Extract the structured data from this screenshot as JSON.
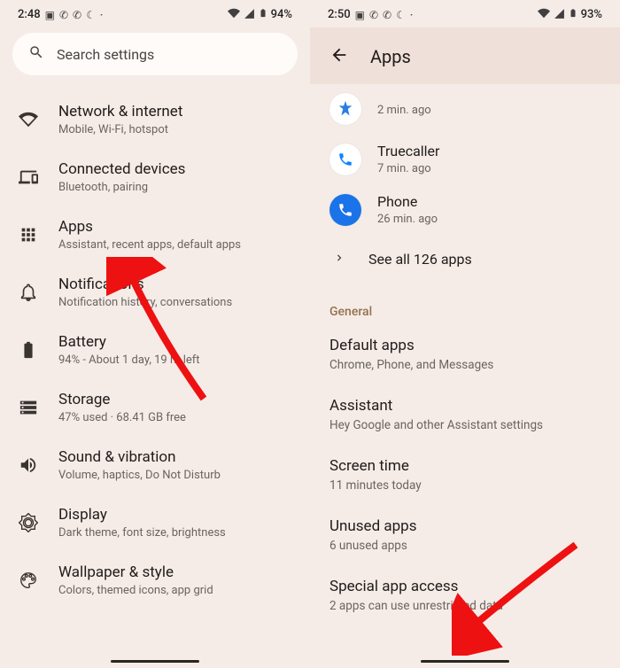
{
  "left": {
    "status": {
      "time": "2:48",
      "battery": "94%"
    },
    "search_placeholder": "Search settings",
    "items": [
      {
        "title": "Network & internet",
        "sub": "Mobile, Wi-Fi, hotspot"
      },
      {
        "title": "Connected devices",
        "sub": "Bluetooth, pairing"
      },
      {
        "title": "Apps",
        "sub": "Assistant, recent apps, default apps"
      },
      {
        "title": "Notifications",
        "sub": "Notification history, conversations"
      },
      {
        "title": "Battery",
        "sub": "94% - About 1 day, 19 hr left"
      },
      {
        "title": "Storage",
        "sub": "47% used · 68.41 GB free"
      },
      {
        "title": "Sound & vibration",
        "sub": "Volume, haptics, Do Not Disturb"
      },
      {
        "title": "Display",
        "sub": "Dark theme, font size, brightness"
      },
      {
        "title": "Wallpaper & style",
        "sub": "Colors, themed icons, app grid"
      }
    ]
  },
  "right": {
    "status": {
      "time": "2:50",
      "battery": "93%"
    },
    "header_title": "Apps",
    "recent": [
      {
        "name": "",
        "sub": "2 min. ago"
      },
      {
        "name": "Truecaller",
        "sub": "7 min. ago"
      },
      {
        "name": "Phone",
        "sub": "26 min. ago"
      }
    ],
    "see_all": "See all 126 apps",
    "section_general": "General",
    "general": [
      {
        "title": "Default apps",
        "sub": "Chrome, Phone, and Messages"
      },
      {
        "title": "Assistant",
        "sub": "Hey Google and other Assistant settings"
      },
      {
        "title": "Screen time",
        "sub": "11 minutes today"
      },
      {
        "title": "Unused apps",
        "sub": "6 unused apps"
      },
      {
        "title": "Special app access",
        "sub": "2 apps can use unrestricted data"
      }
    ]
  }
}
